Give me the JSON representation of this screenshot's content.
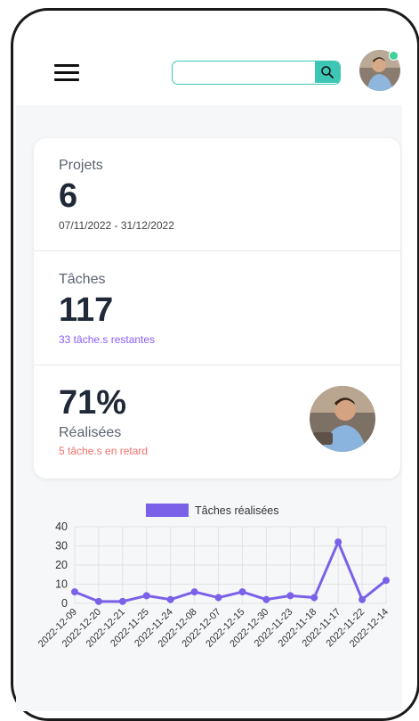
{
  "header": {
    "search_placeholder": "",
    "search_icon": "magnifier-icon",
    "menu_icon": "hamburger-icon",
    "online_color": "#3fd19c",
    "accent": "#3ec6b4"
  },
  "stats": {
    "projects": {
      "label": "Projets",
      "value": "6",
      "period": "07/11/2022 - 31/12/2022"
    },
    "tasks": {
      "label": "Tâches",
      "value": "117",
      "remaining": "33 tâche.s restantes"
    },
    "completion": {
      "value": "71%",
      "label": "Réalisées",
      "late": "5 tâche.s en retard"
    }
  },
  "colors": {
    "purple": "#8b5cf6",
    "red": "#f0706a",
    "dark": "#1f2937"
  },
  "chart_data": {
    "type": "line",
    "legend": [
      "Tâches réalisées"
    ],
    "categories": [
      "2022-12-09",
      "2022-12-20",
      "2022-12-21",
      "2022-11-25",
      "2022-11-24",
      "2022-12-08",
      "2022-12-07",
      "2022-12-15",
      "2022-12-30",
      "2022-11-23",
      "2022-11-18",
      "2022-11-17",
      "2022-11-22",
      "2022-12-14"
    ],
    "series": [
      {
        "name": "Tâches réalisées",
        "values": [
          6,
          1,
          1,
          4,
          2,
          6,
          3,
          6,
          2,
          4,
          3,
          32,
          2,
          12
        ],
        "color": "#7b61e8"
      }
    ],
    "ylim": [
      0,
      40
    ],
    "yticks": [
      "0",
      "10",
      "20",
      "30",
      "40"
    ],
    "grid": true,
    "legend_position": "top"
  }
}
